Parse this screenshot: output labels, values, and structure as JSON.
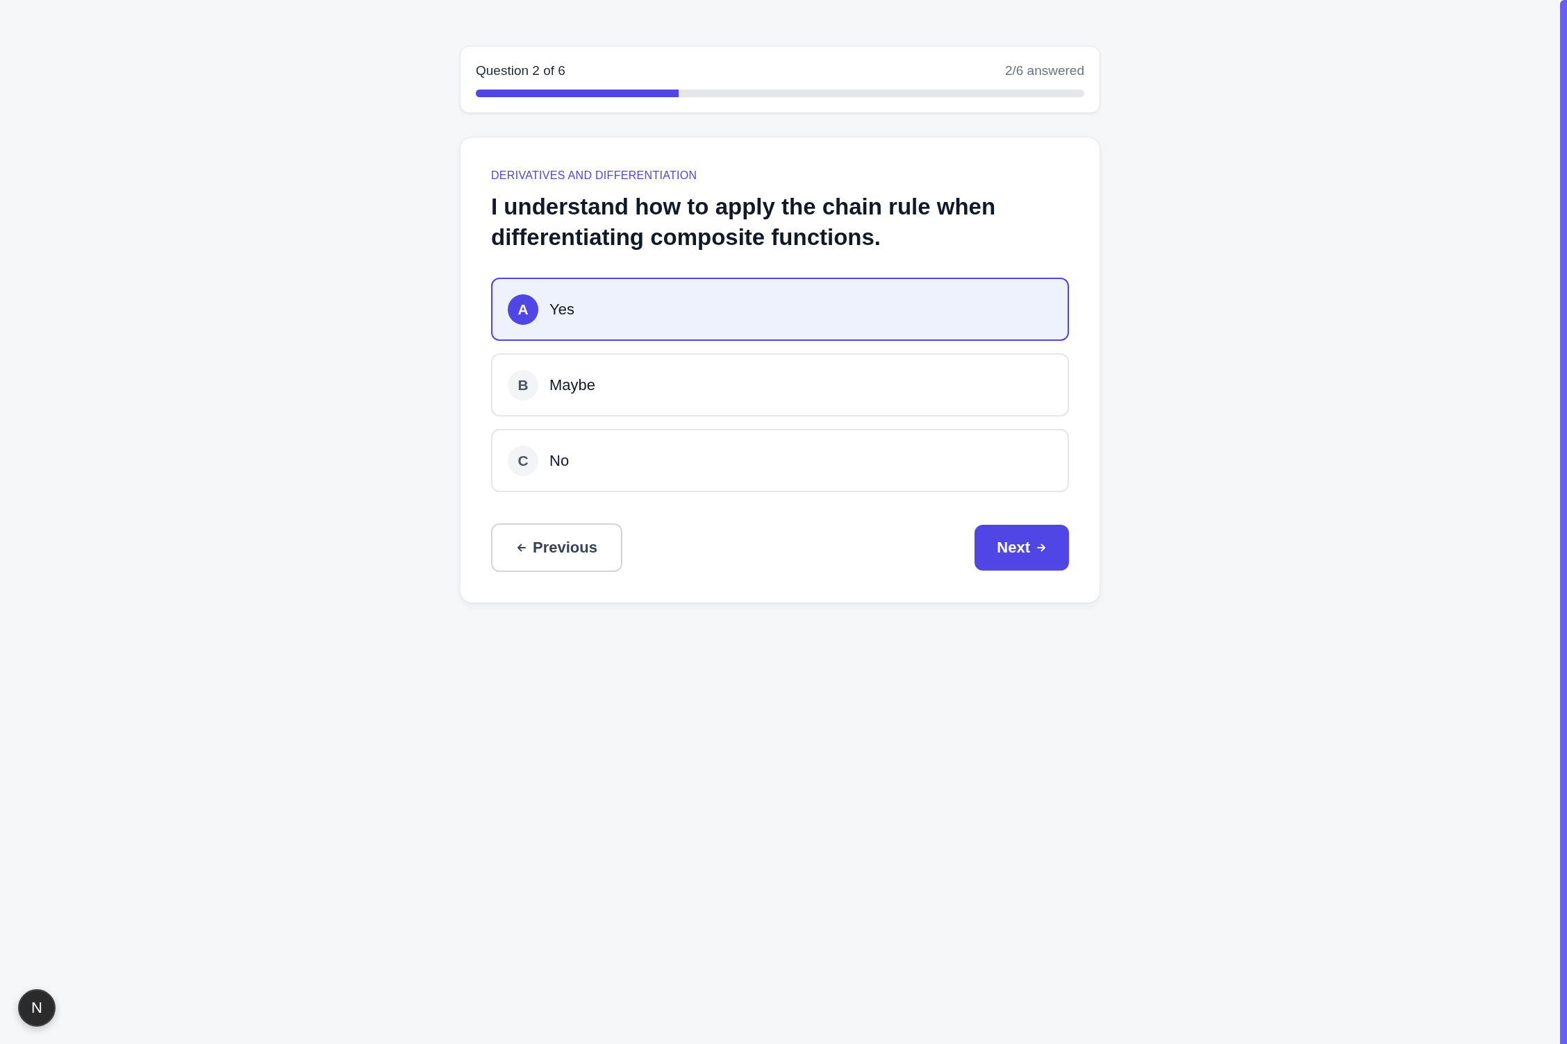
{
  "progress": {
    "label": "Question 2 of 6",
    "answered": "2/6 answered",
    "level": 0.333
  },
  "question": {
    "category": "DERIVATIVES AND DIFFERENTIATION",
    "text": "I understand how to apply the chain rule when differentiating composite functions.",
    "options": [
      {
        "letter": "A",
        "label": "Yes",
        "selected": true
      },
      {
        "letter": "B",
        "label": "Maybe",
        "selected": false
      },
      {
        "letter": "C",
        "label": "No",
        "selected": false
      }
    ]
  },
  "nav": {
    "previous": "Previous",
    "next": "Next"
  },
  "dev_badge": {
    "label": "N"
  }
}
